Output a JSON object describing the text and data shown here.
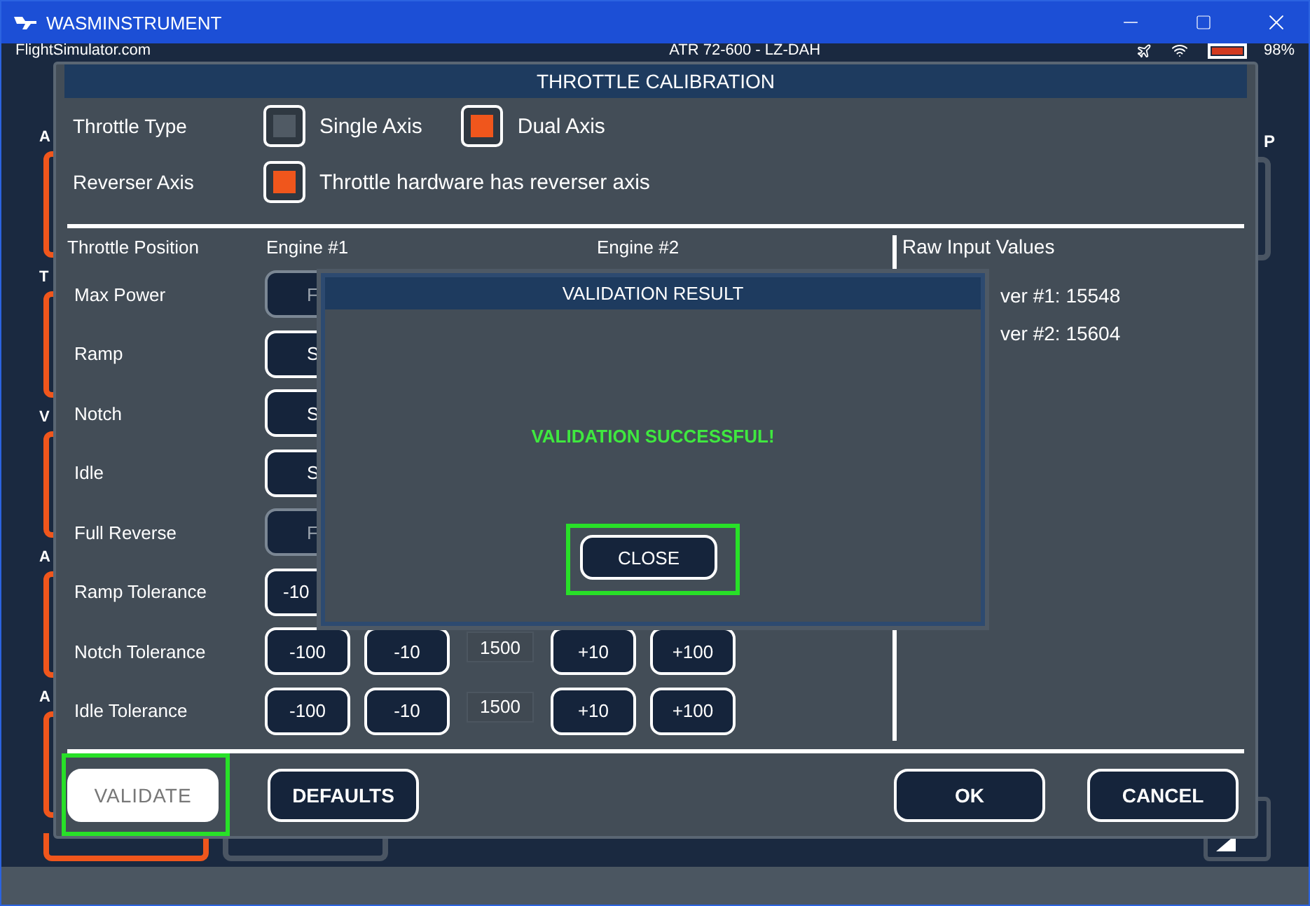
{
  "window": {
    "title": "WASMINSTRUMENT"
  },
  "app_header": {
    "site": "FlightSimulator.com",
    "aircraft": "ATR 72-600 - LZ-DAH",
    "battery": "98%"
  },
  "side_sections": [
    {
      "letter": "A"
    },
    {
      "letter": "T"
    },
    {
      "letter": "V"
    },
    {
      "letter": "A"
    },
    {
      "letter": "A"
    }
  ],
  "right_section": {
    "letter": "P"
  },
  "dialog": {
    "title": "THROTTLE CALIBRATION",
    "throttle_type": {
      "label": "Throttle Type",
      "options": [
        {
          "label": "Single Axis",
          "selected": false
        },
        {
          "label": "Dual Axis",
          "selected": true
        }
      ]
    },
    "reverser": {
      "label": "Reverser Axis",
      "option": {
        "label": "Throttle hardware has reverser axis",
        "checked": true
      }
    },
    "columns": [
      "Throttle Position",
      "Engine #1",
      "Engine #2",
      "Raw Input Values"
    ],
    "position_rows": [
      {
        "label": "Max Power",
        "button": "F",
        "disabled": true
      },
      {
        "label": "Ramp",
        "button": "S",
        "disabled": false
      },
      {
        "label": "Notch",
        "button": "S",
        "disabled": false
      },
      {
        "label": "Idle",
        "button": "S",
        "disabled": false
      },
      {
        "label": "Full Reverse",
        "button": "F",
        "disabled": true
      }
    ],
    "tolerance_rows": [
      {
        "label": "Ramp Tolerance",
        "controls": [
          {
            "kind": "button",
            "text": "-10"
          }
        ]
      },
      {
        "label": "Notch Tolerance",
        "controls": [
          {
            "kind": "button",
            "text": "-100"
          },
          {
            "kind": "button",
            "text": "-10"
          },
          {
            "kind": "value",
            "text": "1500"
          },
          {
            "kind": "button",
            "text": "+10"
          },
          {
            "kind": "button",
            "text": "+100"
          }
        ]
      },
      {
        "label": "Idle Tolerance",
        "controls": [
          {
            "kind": "button",
            "text": "-100"
          },
          {
            "kind": "button",
            "text": "-10"
          },
          {
            "kind": "value",
            "text": "1500"
          },
          {
            "kind": "button",
            "text": "+10"
          },
          {
            "kind": "button",
            "text": "+100"
          }
        ]
      }
    ],
    "raw_values": [
      "ver #1: 15548",
      "ver #2: 15604"
    ],
    "left_buttons": [
      {
        "label": "VALIDATE",
        "focused": true,
        "highlighted": true
      },
      {
        "label": "DEFAULTS",
        "focused": false,
        "highlighted": false
      }
    ],
    "right_buttons": [
      {
        "label": "OK",
        "focused": false,
        "highlighted": false
      },
      {
        "label": "CANCEL",
        "focused": false,
        "highlighted": false
      }
    ]
  },
  "validation": {
    "title": "VALIDATION RESULT",
    "message": "VALIDATION SUCCESSFUL!",
    "button": {
      "label": "CLOSE",
      "highlighted": true
    }
  }
}
